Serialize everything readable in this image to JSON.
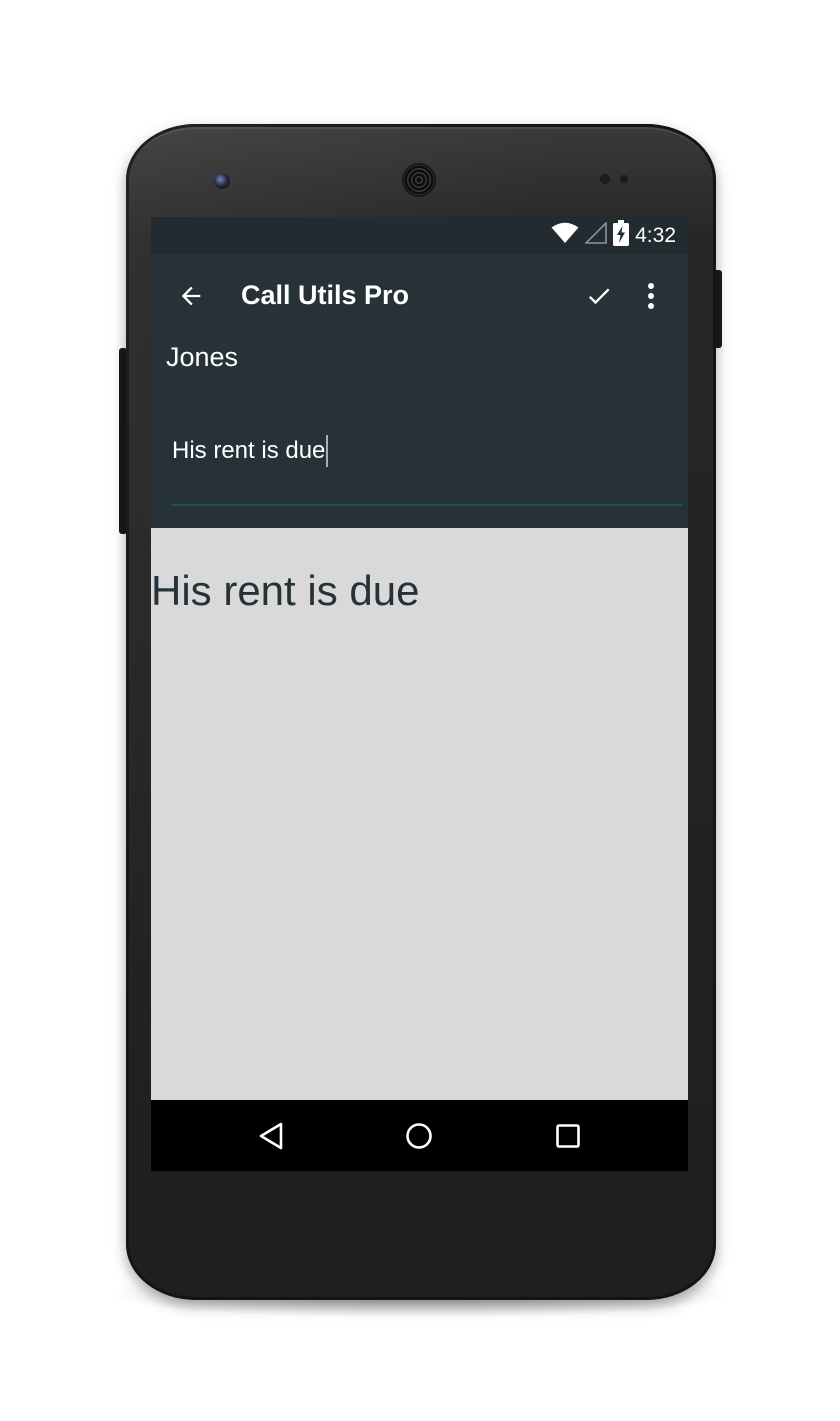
{
  "status_bar": {
    "time": "4:32",
    "icons": [
      "wifi-icon",
      "cell-signal-icon",
      "battery-charging-icon"
    ]
  },
  "app_bar": {
    "title": "Call Utils Pro",
    "back_icon": "arrow-left-icon",
    "save_icon": "checkmark-icon",
    "menu_icon": "more-vertical-icon"
  },
  "contact": {
    "name": "Jones"
  },
  "note": {
    "value": "His rent is due"
  },
  "preview": {
    "text": "His rent is due"
  },
  "nav_bar": {
    "icons": [
      "back-triangle-icon",
      "home-circle-icon",
      "recents-square-icon"
    ]
  },
  "colors": {
    "app_bar_bg": "#263238",
    "status_bar_bg": "#222b30",
    "content_bg": "#d9d9d9",
    "accent": "#18545a",
    "preview_text": "#263238"
  }
}
